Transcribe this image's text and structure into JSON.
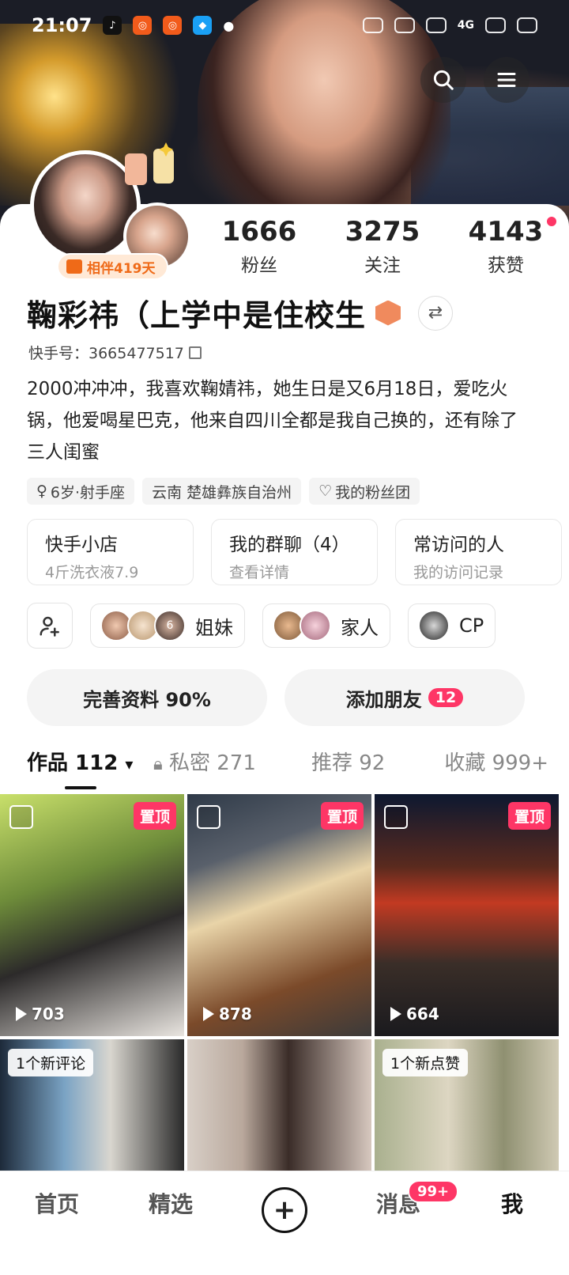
{
  "status_bar": {
    "time": "21:07",
    "network": "4G"
  },
  "profile": {
    "companion_label": "相伴419天",
    "stats": [
      {
        "value": "1666",
        "label": "粉丝"
      },
      {
        "value": "3275",
        "label": "关注"
      },
      {
        "value": "4143",
        "label": "获赞"
      }
    ],
    "name": "鞠彩祎（上学中是住校生",
    "uid": "快手号：3665477517",
    "bio": "2000冲冲冲，我喜欢鞠婧祎，她生日是又6月18日，爱吃火锅，他爱喝星巴克，他来自四川全都是我自己换的，还有除了三人闺蜜",
    "tags": [
      "6岁·射手座",
      "云南 楚雄彝族自治州",
      "我的粉丝团"
    ]
  },
  "shortcuts": [
    {
      "title": "快手小店",
      "sub": "4斤洗衣液7.9"
    },
    {
      "title": "我的群聊（4）",
      "sub": "查看详情"
    },
    {
      "title": "常访问的人",
      "sub": "我的访问记录"
    }
  ],
  "groups": [
    {
      "label": "姐妹",
      "overlay": "6"
    },
    {
      "label": "家人"
    },
    {
      "label": "CP"
    }
  ],
  "actions": {
    "complete_profile": "完善资料 90%",
    "add_friends": "添加朋友",
    "add_friends_count": "12"
  },
  "tabs": [
    {
      "label": "作品 112",
      "caret": "▾"
    },
    {
      "label": "私密 271"
    },
    {
      "label": "推荐 92"
    },
    {
      "label": "收藏 999+"
    }
  ],
  "grid": [
    {
      "pinned": "置顶",
      "plays": "703"
    },
    {
      "pinned": "置顶",
      "plays": "878"
    },
    {
      "pinned": "置顶",
      "plays": "664"
    },
    {
      "note": "1个新评论"
    },
    {},
    {
      "note": "1个新点赞"
    }
  ],
  "bottom_nav": {
    "home": "首页",
    "featured": "精选",
    "add": "+",
    "messages": "消息",
    "messages_badge": "99+",
    "me": "我"
  },
  "colors": {
    "accent": "#fe3666",
    "companion": "#ef6a18"
  }
}
